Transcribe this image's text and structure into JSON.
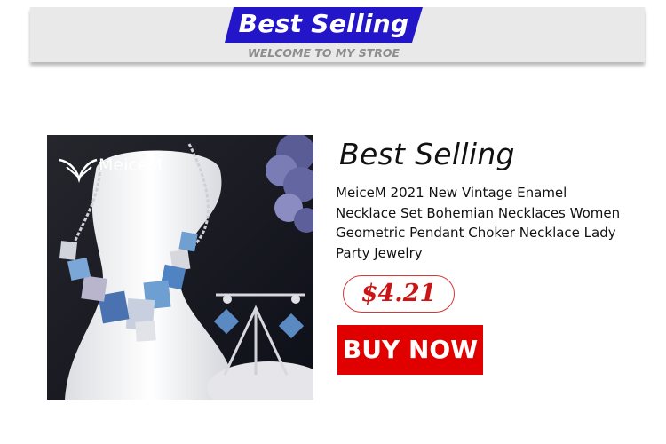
{
  "header": {
    "title": "Best Selling",
    "subtitle": "WELCOME TO MY STROE"
  },
  "product": {
    "brand": "MeiceM",
    "promo_title": "Best Selling",
    "name": "MeiceM 2021 New Vintage Enamel Necklace Set Bohemian Necklaces Women Geometric Pendant Choker Necklace Lady Party Jewelry",
    "price": "$4.21",
    "buy_label": "BUY NOW"
  },
  "colors": {
    "banner": "#2316c9",
    "buy_button": "#e10000",
    "price_text": "#cc1414",
    "header_bg": "#e9e9e9"
  }
}
